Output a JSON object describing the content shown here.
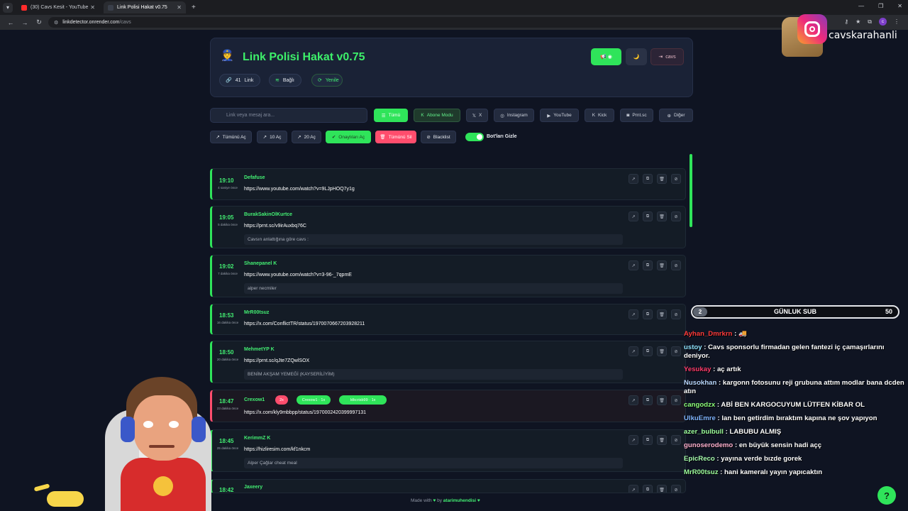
{
  "browser": {
    "tabs": [
      {
        "title": "(30) Cavs Kesit - YouTube",
        "active": false
      },
      {
        "title": "Link Polisi Hakat v0.75",
        "active": true
      }
    ],
    "url_host": "linkdetector.onrender.com",
    "url_path": "/cavs"
  },
  "header": {
    "title": "Link Polisi Hakat v0.75",
    "link_count": "41",
    "link_label": "Link",
    "status": "Bağlı",
    "refresh": "Yenile",
    "logout": "cavs"
  },
  "search": {
    "placeholder": "Link veya mesaj ara..."
  },
  "filters": [
    "Tümü",
    "Abone Modu",
    "X",
    "Instagram",
    "YouTube",
    "Kick",
    "Prnt.sc",
    "Diğer"
  ],
  "actions": {
    "open_all": "Tümünü Aç",
    "open_10": "10 Aç",
    "open_20": "20 Aç",
    "open_approved": "Onaylıları Aç",
    "delete_all": "Tümünü Sil",
    "blacklist": "Blacklist",
    "hide_bots": "Bot'ları Gizle"
  },
  "messages": [
    {
      "time": "19:10",
      "ago": "4 saniye önce",
      "user": "Defafuse",
      "link": "https://www.youtube.com/watch?v=9LJpHOQ7y1g",
      "note": ""
    },
    {
      "time": "19:05",
      "ago": "5 dakika önce",
      "user": "BurakSakinOlKurtce",
      "link": "https://prnt.sc/v9irAuxbq76C",
      "note": "Cavsın anlattığına göre cavs :"
    },
    {
      "time": "19:02",
      "ago": "7 dakika önce",
      "user": "Shanepanel",
      "link": "https://www.youtube.com/watch?v=3-96-_7qpmE",
      "note": "alper necmiler"
    },
    {
      "time": "18:53",
      "ago": "16 dakika önce",
      "user": "MrR00tsuz",
      "link": "https://x.com/ConflictTR/status/1970070667203928211",
      "note": ""
    },
    {
      "time": "18:50",
      "ago": "20 dakika önce",
      "user": "MehmetYP",
      "link": "https://prnt.sc/qJte7ZQwlSOX",
      "note": "BENİM AKŞAM YEMEĞİ (KAYSERİLİYİM)"
    },
    {
      "time": "18:47",
      "ago": "23 dakika önce",
      "user": "Crexow1",
      "count": "2x",
      "tag1": "Crexow1 · 1x",
      "tag2": "Idkcrisb99 · 1x",
      "link": "https://x.com/kly9mbbpp/status/1970002420399997131",
      "note": ""
    },
    {
      "time": "18:45",
      "ago": "25 dakika önce",
      "user": "KerimmZ",
      "link": "https://hizliresim.com/kf1nkcm",
      "note": "Alper Çağlar cheat meal"
    },
    {
      "time": "18:42",
      "ago": "",
      "user": "Jaxeery",
      "link": "",
      "note": ""
    }
  ],
  "footer": {
    "prefix": "Made with",
    "by": "by",
    "author": "atarimuhendisi"
  },
  "overlay": {
    "instagram_handle": "cavskarahanli",
    "sub_left": "2",
    "sub_title": "GÜNLUK SUB",
    "sub_right": "50",
    "chat": [
      {
        "user": "Ayhan_Dmrkrn",
        "color": "#ff3b3b",
        "text": " : 🚚"
      },
      {
        "user": "ustoy",
        "color": "#8fe3ff",
        "text": " : Cavs sponsorlu firmadan gelen fantezi iç çamaşırlarını deniyor."
      },
      {
        "user": "Yesukay",
        "color": "#ff3b6b",
        "text": " : aç artık"
      },
      {
        "user": "Nusokhan",
        "color": "#b9d8ff",
        "text": " : kargonn fotosunu reji grubuna attım modlar bana dcden atın"
      },
      {
        "user": "cangodzx",
        "color": "#8dff7a",
        "text": " : ABİ BEN KARGOCUYUM LÜTFEN KİBAR OL"
      },
      {
        "user": "UlkuEmre",
        "color": "#7fb4ff",
        "text": " : lan ben getirdim bıraktım kapına ne şov yapıyon"
      },
      {
        "user": "azer_bulbull",
        "color": "#9dff9d",
        "text": " : LABUBU ALMIŞ"
      },
      {
        "user": "gunoserodemo",
        "color": "#ffb1d0",
        "text": " : en büyük sensin hadi açç"
      },
      {
        "user": "EpicReco",
        "color": "#a8ffb0",
        "text": " : yayına verde bızde gorek"
      },
      {
        "user": "MrR00tsuz",
        "color": "#9dff9d",
        "text": " : hani kameralı yayın yapıcaktın"
      }
    ]
  },
  "colors": {
    "accent": "#2fe45a",
    "danger": "#ff4d6d",
    "background": "#0f1422"
  }
}
